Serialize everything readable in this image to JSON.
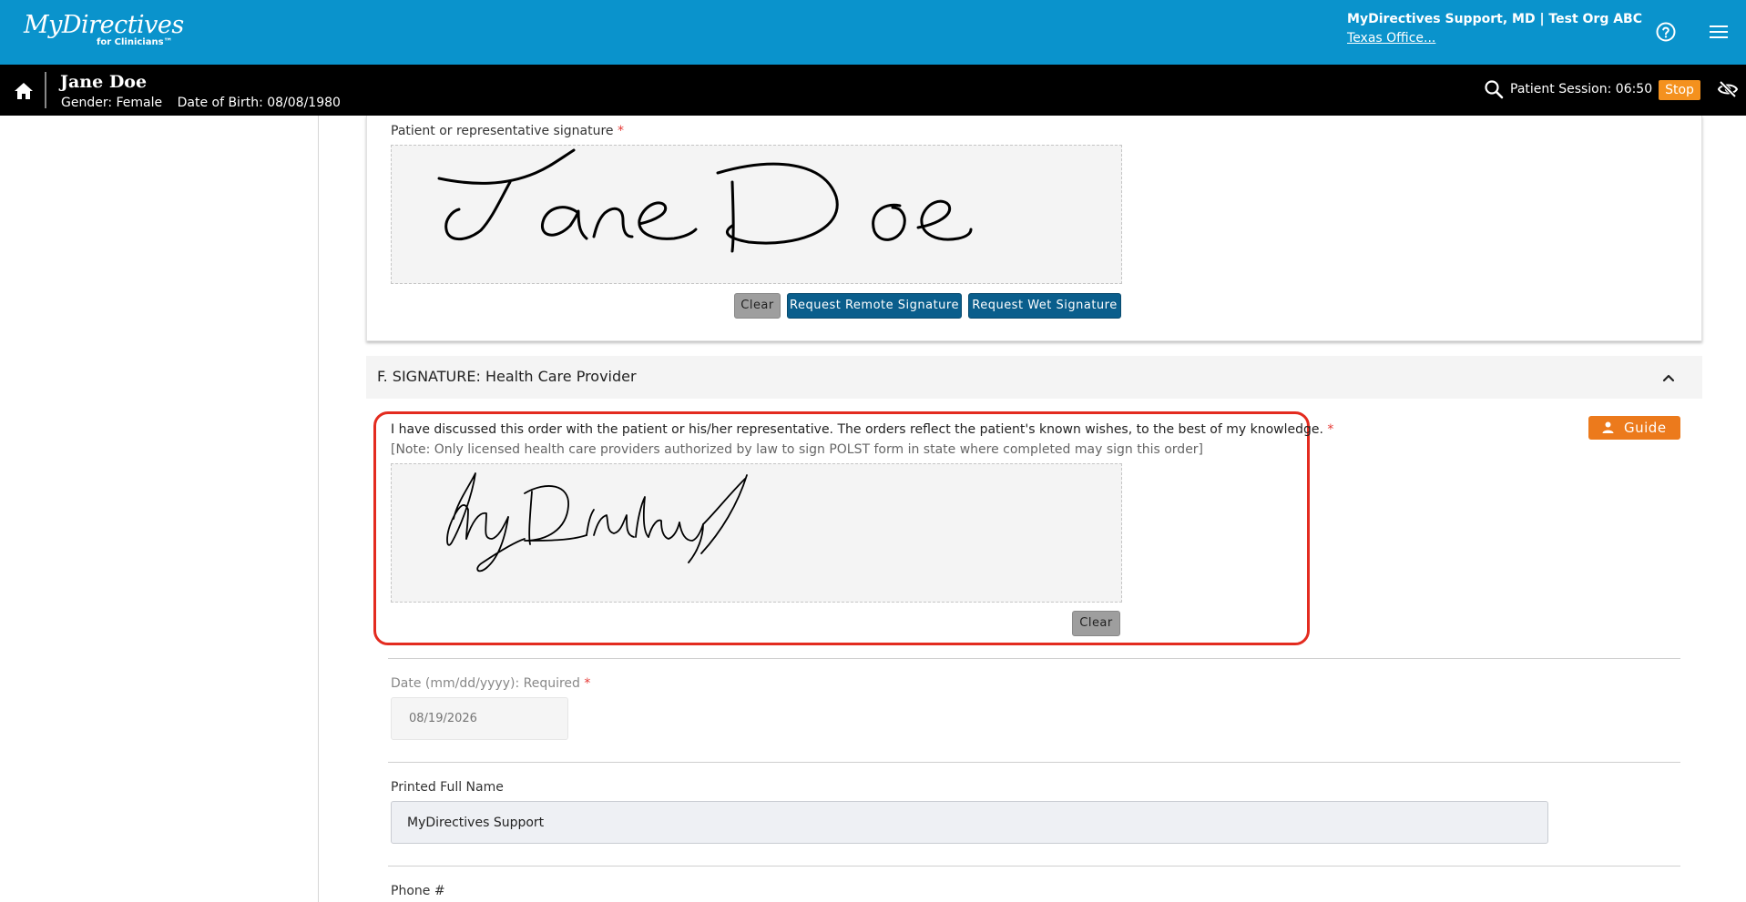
{
  "header": {
    "logo_main": "MyDirectives",
    "logo_sub": "for Clinicians™",
    "user_name": "MyDirectives Support, MD | Test Org ABC",
    "user_office": "Texas Office..."
  },
  "patient": {
    "name": "Jane Doe",
    "gender": "Gender: Female",
    "dob": "Date of Birth: 08/08/1980",
    "session": "Patient Session: 06:50",
    "stop_label": "Stop"
  },
  "section_e": {
    "signature_label": "Patient or representative signature",
    "required_mark": "*",
    "clear_label": "Clear",
    "remote_label": "Request Remote Signature",
    "wet_label": "Request Wet Signature"
  },
  "section_f": {
    "title": "F. SIGNATURE: Health Care Provider",
    "attestation": "I have discussed this order with the patient or his/her representative. The orders reflect the patient's known wishes, to the best of my knowledge.",
    "required_mark": "*",
    "note": "[Note: Only licensed health care providers authorized by law to sign POLST form in state where completed may sign this order]",
    "clear_label": "Clear",
    "guide_label": "Guide",
    "date_label": "Date (mm/dd/yyyy): Required",
    "date_placeholder": "08/19/2026",
    "printed_name_label": "Printed Full Name",
    "printed_name_value": "MyDirectives Support",
    "phone_label": "Phone #"
  },
  "colors": {
    "topbar": "#0a93cc",
    "patientbar": "#000000",
    "stop": "#f4911e",
    "primary_button": "#0a5e8c",
    "guide": "#ec7a1c",
    "highlight": "#e32b1f",
    "required": "#e53935"
  }
}
